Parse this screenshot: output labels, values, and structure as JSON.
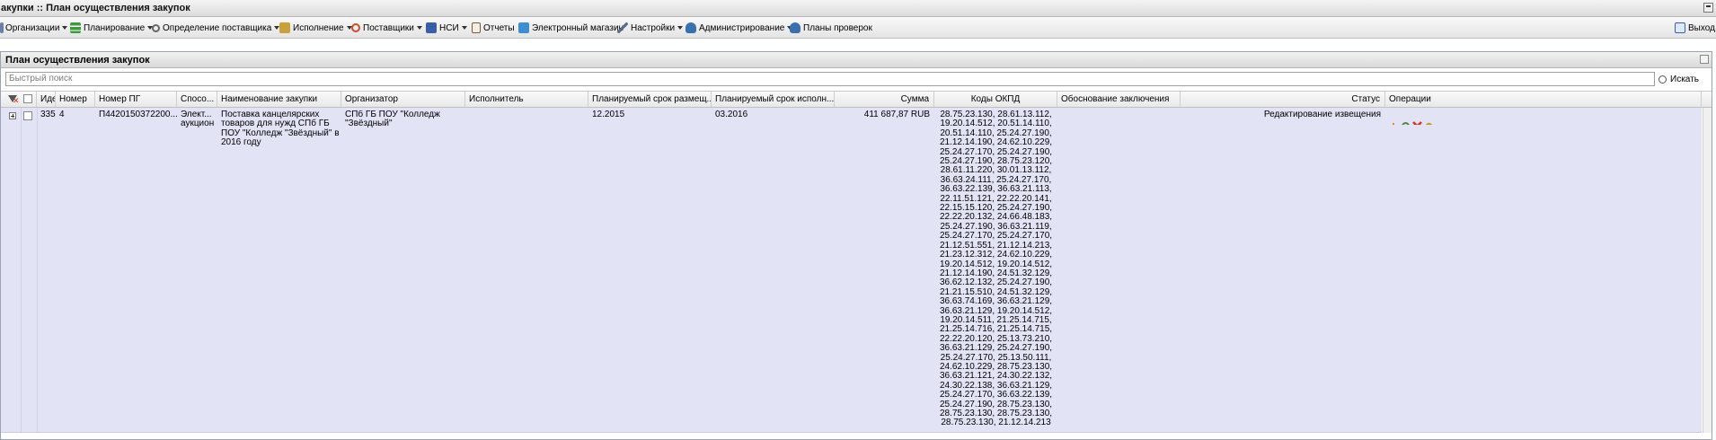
{
  "window": {
    "title": "акупки :: План осуществления закупок"
  },
  "menu": [
    {
      "label": "Организации",
      "icon": "org-icon",
      "dropdown": true
    },
    {
      "label": "Планирование",
      "icon": "planning-icon",
      "dropdown": true
    },
    {
      "label": "Определение поставщика",
      "icon": "gear-icon",
      "dropdown": true
    },
    {
      "label": "Исполнение",
      "icon": "execution-icon",
      "dropdown": true
    },
    {
      "label": "Поставщики",
      "icon": "suppliers-icon",
      "dropdown": true
    },
    {
      "label": "НСИ",
      "icon": "nsi-icon",
      "dropdown": true
    },
    {
      "label": "Отчеты",
      "icon": "reports-icon",
      "dropdown": false
    },
    {
      "label": "Электронный магазин",
      "icon": "shop-icon",
      "dropdown": false
    },
    {
      "label": "Настройки",
      "icon": "wrench-icon",
      "dropdown": true
    },
    {
      "label": "Администрирование",
      "icon": "admin-user-icon",
      "dropdown": true
    },
    {
      "label": "Планы проверок",
      "icon": "inspection-user-icon",
      "dropdown": false
    }
  ],
  "logout": {
    "label": "Выход"
  },
  "panel": {
    "title": "План осуществления закупок"
  },
  "search": {
    "placeholder": "Быстрый поиск",
    "button_label": "Искать"
  },
  "columns": [
    {
      "key": "id",
      "label": "Иде"
    },
    {
      "key": "number",
      "label": "Номер"
    },
    {
      "key": "pg_number",
      "label": "Номер ПГ"
    },
    {
      "key": "method",
      "label": "Спосо..."
    },
    {
      "key": "name",
      "label": "Наименование закупки"
    },
    {
      "key": "organizer",
      "label": "Организатор"
    },
    {
      "key": "executor",
      "label": "Исполнитель"
    },
    {
      "key": "placement_date",
      "label": "Планируемый срок размещ..."
    },
    {
      "key": "execution_date",
      "label": "Планируемый срок исполн..."
    },
    {
      "key": "sum",
      "label": "Сумма"
    },
    {
      "key": "okpd",
      "label": "Коды ОКПД"
    },
    {
      "key": "justification",
      "label": "Обоснование заключения"
    },
    {
      "key": "status",
      "label": "Статус"
    },
    {
      "key": "operations",
      "label": "Операции"
    }
  ],
  "rows": [
    {
      "id": "335",
      "number": "4",
      "pg_number": "П4420150372200...",
      "method": "Элект...\nаукцион",
      "name": "Поставка канцелярских\nтоваров для нужд СПб ГБ\nПОУ \"Колледж \"Звёздный\" в\n2016 году",
      "organizer": "СПб ГБ ПОУ \"Колледж\n\"Звёздный\"",
      "executor": "",
      "placement_date": "12.2015",
      "execution_date": "03.2016",
      "sum": "411 687,87 RUB",
      "okpd": "28.75.23.130, 28.61.13.112,\n19.20.14.512, 20.51.14.110,\n20.51.14.110, 25.24.27.190,\n21.12.14.190, 24.62.10.229,\n25.24.27.170, 25.24.27.190,\n25.24.27.190, 28.75.23.120,\n28.61.11.220, 30.01.13.112,\n36.63.24.111, 25.24.27.170,\n36.63.22.139, 36.63.21.113,\n22.11.51.121, 22.22.20.141,\n22.15.15.120, 25.24.27.190,\n22.22.20.132, 24.66.48.183,\n25.24.27.190, 36.63.21.119,\n25.24.27.170, 25.24.27.170,\n21.12.51.551, 21.12.14.213,\n21.23.12.312, 24.62.10.229,\n19.20.14.512, 19.20.14.512,\n21.12.14.190, 24.51.32.129,\n36.62.12.132, 25.24.27.190,\n21.21.15.510, 24.51.32.129,\n36.63.74.169, 36.63.21.129,\n36.63.21.129, 19.20.14.512,\n19.20.14.511, 21.25.14.715,\n21.25.14.716, 21.25.14.715,\n22.22.20.120, 25.13.73.210,\n36.63.21.129, 25.24.27.190,\n25.24.27.170, 25.13.50.111,\n24.62.10.229, 28.75.23.130,\n36.63.21.121, 24.30.22.132,\n24.30.22.138, 36.63.21.129,\n25.24.27.170, 36.63.22.139,\n25.24.27.190, 28.75.23.130,\n28.75.23.130, 28.75.23.130,\n28.75.23.130, 21.12.14.213",
      "justification": "",
      "status": "Редактирование извещения",
      "operations": [
        "chart-icon",
        "refresh-gear-icon",
        "delete-icon",
        "settings-icon"
      ]
    }
  ],
  "colors": {
    "row_bg": "#e3e3f6",
    "panel_border": "#99a3b3",
    "delete": "#e0321c"
  }
}
